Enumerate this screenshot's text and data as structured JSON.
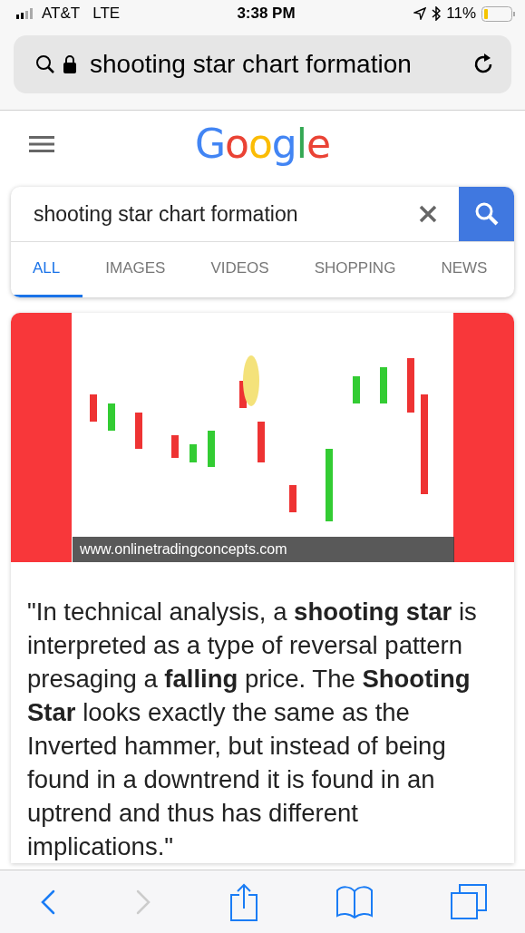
{
  "status_bar": {
    "carrier": "AT&T",
    "network": "LTE",
    "time": "3:38 PM",
    "battery": "11%"
  },
  "address_bar": {
    "url": "shooting star chart formation"
  },
  "header": {
    "logo": "Google"
  },
  "search": {
    "value": "shooting star chart formation"
  },
  "tabs": [
    {
      "label": "ALL",
      "selected": true
    },
    {
      "label": "IMAGES",
      "selected": false
    },
    {
      "label": "VIDEOS",
      "selected": false
    },
    {
      "label": "SHOPPING",
      "selected": false
    },
    {
      "label": "NEWS",
      "selected": false
    }
  ],
  "result": {
    "source": "www.onlinetradingconcepts.com",
    "snippet": "\"In technical analysis, a **shooting star** is interpreted as a type of reversal pattern presaging a **falling** price. The **Shooting Star** looks exactly the same as the Inverted hammer, but instead of being found in a downtrend it is found in an uptrend and thus has different implications.\""
  },
  "toolbar": {
    "back_disabled": false,
    "forward_disabled": true
  }
}
